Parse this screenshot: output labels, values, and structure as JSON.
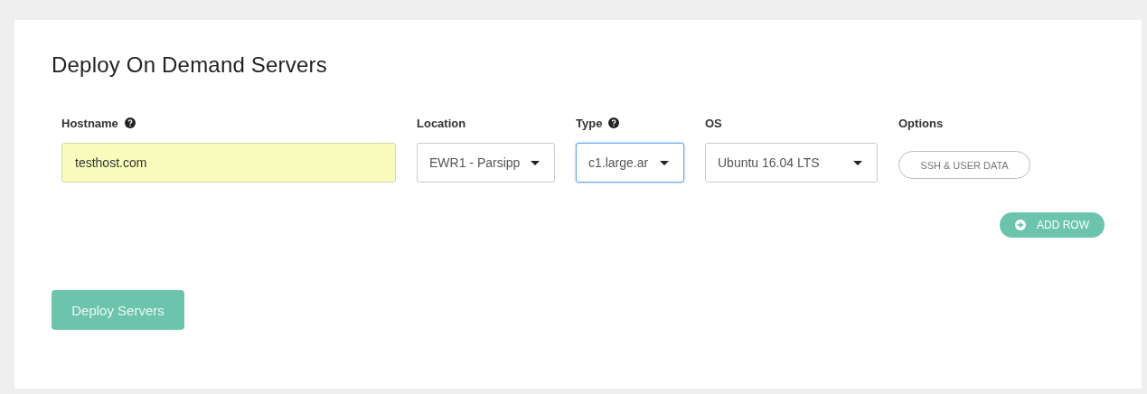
{
  "title": "Deploy On Demand Servers",
  "columns": [
    {
      "label": "Hostname",
      "help": true,
      "kind": "input",
      "value": "testhost.com",
      "autofilled": true,
      "focused": false
    },
    {
      "label": "Location",
      "help": false,
      "kind": "select",
      "value": "EWR1 - Parsipp",
      "autofilled": false,
      "focused": false
    },
    {
      "label": "Type",
      "help": true,
      "kind": "select",
      "value": "c1.large.ar",
      "autofilled": false,
      "focused": true
    },
    {
      "label": "OS",
      "help": false,
      "kind": "select",
      "value": "Ubuntu 16.04 LTS",
      "autofilled": false,
      "focused": false
    },
    {
      "label": "Options",
      "help": false,
      "kind": "button",
      "value": "SSH & USER DATA"
    }
  ],
  "add_row": "ADD ROW",
  "deploy": "Deploy Servers"
}
